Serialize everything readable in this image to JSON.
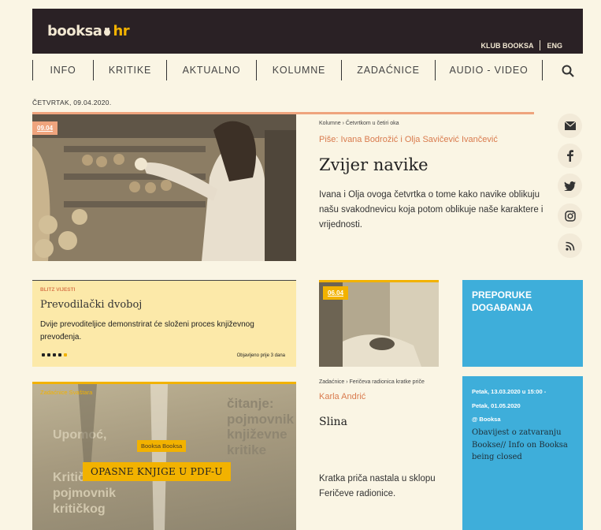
{
  "brand": {
    "logo_main": "booksa",
    "logo_suffix": "hr",
    "icon": "mascot-icon"
  },
  "top_links": {
    "club": "KLUB BOOKSA",
    "lang": "ENG"
  },
  "nav": {
    "items": [
      "INFO",
      "KRITIKE",
      "AKTUALNO",
      "KOLUMNE",
      "ZADAĆNICE",
      "AUDIO - VIDEO"
    ],
    "search_icon": "search-icon"
  },
  "date": "ČETVRTAK, 09.04.2020.",
  "featured": {
    "badge": "09.04",
    "category": "Kolumne › Četvrtkom u četiri oka",
    "author": "Piše: Ivana Bodrožić i Olja Savičević Ivančević",
    "title": "Zvijer navike",
    "lead": "Ivana i Olja ovoga četvrtka o tome kako navike oblikuju našu svakodnevicu koja potom oblikuje naše karaktere i vrijednosti."
  },
  "social": [
    "mail-icon",
    "facebook-icon",
    "twitter-icon",
    "instagram-icon",
    "rss-icon"
  ],
  "blitz": {
    "tag": "BLITZ VIJESTI",
    "title": "Prevodilački dvoboj",
    "text": "Dvije prevoditeljice demonstrirat će složeni proces književnog prevođenja.",
    "published": "Objavljeno prije 3 dana"
  },
  "story": {
    "badge": "06.04",
    "category": "Zadaćnice › Feričeva radionica kratke priče",
    "author": "Karla Andrić",
    "title": "Slina",
    "lead": "Kratka priča nastala u sklopu Feričeve radionice."
  },
  "events_box": {
    "title": "PREPORUKE DOGAĐANJA"
  },
  "event": {
    "from": "Petak, 13.03.2020 u 15:00 -",
    "to": "Petak, 01.05.2020",
    "place": "@ Booksa",
    "title": "Obavijest o zatvaranju Bookse// Info on Booksa being closed"
  },
  "promo": {
    "tag": "Zadaćnice Svaštara",
    "label": "Booksa Booksa",
    "title": "OPASNE KNJIGE U PDF-U",
    "bg_text_right": [
      "čitanje:",
      "pojmovnik",
      "književne",
      "kritike"
    ],
    "bg_text_left": [
      "Upomoć,",
      "Kritički",
      "pojmovnik",
      "kritičkog"
    ]
  },
  "colors": {
    "topbar": "#2a2125",
    "accent_orange": "#efa47d",
    "accent_yellow": "#f2b200",
    "blue_box": "#3eaeda",
    "background": "#faf5e4"
  }
}
